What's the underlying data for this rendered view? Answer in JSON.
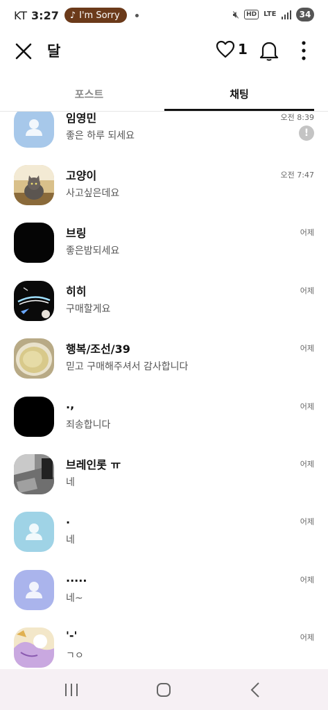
{
  "status": {
    "carrier": "KT",
    "time": "3:27",
    "music_label": "I'm Sorry",
    "battery": "34",
    "hd": "HD",
    "lte": "LTE"
  },
  "header": {
    "title": "달",
    "like_count": "1"
  },
  "tabs": [
    {
      "label": "포스트",
      "active": false
    },
    {
      "label": "채팅",
      "active": true
    }
  ],
  "chats": [
    {
      "name": "임영민",
      "message": "좋은 하루 되세요",
      "time": "오전 8:39",
      "warning": "!",
      "avatar": "default-blue"
    },
    {
      "name": "고양이",
      "message": "사고싶은데요",
      "time": "오전 7:47",
      "avatar": "cat-photo"
    },
    {
      "name": "브링",
      "message": "좋은밤되세요",
      "time": "어제",
      "avatar": "black"
    },
    {
      "name": "히히",
      "message": "구매할게요",
      "time": "어제",
      "avatar": "neon-logo"
    },
    {
      "name": "행복/조선/39",
      "message": "믿고 구매해주셔서 감사합니다",
      "time": "어제",
      "avatar": "cup-photo"
    },
    {
      "name": ".,",
      "message": "죄송합니다",
      "time": "어제",
      "avatar": "black"
    },
    {
      "name": "브레인롯 ㅠ",
      "message": "네",
      "time": "어제",
      "avatar": "room-photo"
    },
    {
      "name": ".",
      "message": "네",
      "time": "어제",
      "avatar": "default-cyan"
    },
    {
      "name": ".....",
      "message": "네~",
      "time": "어제",
      "avatar": "default-lavender"
    },
    {
      "name": "'-'",
      "message": "ㄱㅇ",
      "time": "어제",
      "avatar": "illustration"
    }
  ],
  "colors": {
    "default_blue": "#a7c8ea",
    "default_cyan": "#9fd3e6",
    "default_lavender": "#aab4ec",
    "music_pill": "#6b3a1a",
    "navbar": "#f6f0f4"
  },
  "icons": [
    "close-icon",
    "heart-icon",
    "bell-icon",
    "more-icon",
    "recent-apps-icon",
    "home-icon",
    "back-icon"
  ]
}
